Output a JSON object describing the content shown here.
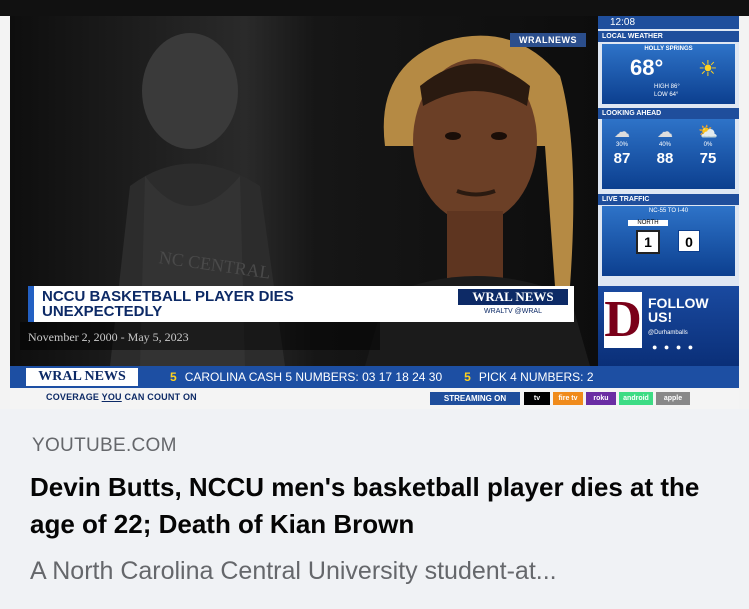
{
  "thumbnail": {
    "wral_bug": "WRALNEWS",
    "sidebar": {
      "time": "12:08",
      "local_weather": "LOCAL WEATHER",
      "city": "HOLLY SPRINGS",
      "temp": "68°",
      "high": "HIGH 86°",
      "low": "LOW 64°",
      "looking_ahead": "LOOKING AHEAD",
      "forecast": [
        {
          "pct": "30%",
          "temp": "87"
        },
        {
          "pct": "40%",
          "temp": "88"
        },
        {
          "pct": "0%",
          "temp": "75"
        }
      ],
      "live_traffic": "LIVE TRAFFIC",
      "traffic_sub": "NC-55 TO I-40",
      "traffic_dir": "NORTH",
      "route": "1",
      "delay": "0"
    },
    "promo": {
      "text_line1": "FOLLOW",
      "text_line2": "US!",
      "handle": "@Durhamballs",
      "letter": "D"
    },
    "lower_third": {
      "line1": "NCCU BASKETBALL PLAYER DIES",
      "line2": "UNEXPECTEDLY",
      "logo": "WRAL NEWS",
      "social": "WRALTV  @WRAL"
    },
    "dates": "November 2, 2000 - May 5, 2023",
    "ticker": {
      "logo": "WRAL NEWS",
      "num": "5",
      "text1": "CAROLINA CASH 5 NUMBERS: 03 17 18 24 30",
      "text2": "PICK 4 NUMBERS: 2"
    },
    "coverage_prefix": "COVERAGE ",
    "coverage_you": "YOU",
    "coverage_suffix": " CAN COUNT ON",
    "streaming": "STREAMING ON",
    "stream_logos": [
      "tv",
      "fire tv",
      "roku",
      "android",
      "apple"
    ]
  },
  "card": {
    "domain": "YOUTUBE.COM",
    "headline": "Devin Butts, NCCU men's basketball player dies at the age of 22; Death of Kian Brown",
    "description": "A North Carolina Central University student-at..."
  },
  "colors": {
    "wral_blue": "#1d4fa3",
    "lower_third_text": "#0d2a66",
    "headline": "#050505",
    "muted": "#65676b",
    "card_bg": "#f0f2f5"
  }
}
